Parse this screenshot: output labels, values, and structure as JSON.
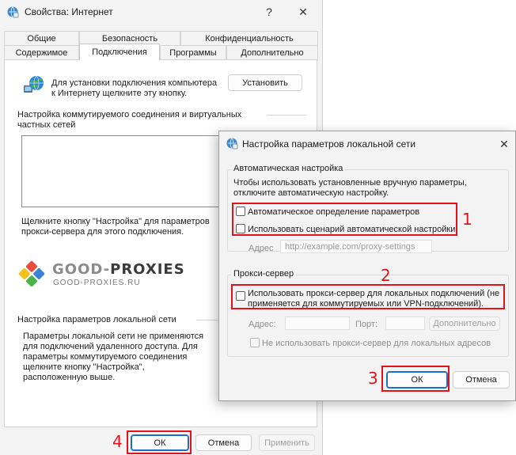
{
  "main_window": {
    "title": "Свойства: Интернет",
    "help_glyph": "?",
    "close_glyph": "✕",
    "tabs_row1": [
      "Общие",
      "Безопасность",
      "Конфиденциальность"
    ],
    "tabs_row2": [
      "Содержимое",
      "Подключения",
      "Программы",
      "Дополнительно"
    ],
    "setup_text_line1": "Для установки подключения компьютера",
    "setup_text_line2": "к Интернету щелкните эту кнопку.",
    "install_button": "Установить",
    "dialup_heading_line1": "Настройка коммутируемого соединения и виртуальных",
    "dialup_heading_line2": "частных сетей",
    "proxy_hint_line1": "Щелкните кнопку \"Настройка\" для параметров",
    "proxy_hint_line2": "прокси-сервера для этого подключения.",
    "watermark_logo_word1": "GOOD-",
    "watermark_logo_word2": "PROXIES",
    "watermark_logo_sub": "GOOD-PROXIES.RU",
    "lan_heading": "Настройка параметров локальной сети",
    "lan_text_line1": "Параметры локальной сети не применяются",
    "lan_text_line2": "для подключений удаленного доступа. Для",
    "lan_text_line3": "параметры коммутируемого соединения",
    "lan_text_line4": "щелкните кнопку \"Настройка\",",
    "lan_text_line5": "расположенную выше.",
    "ok_button": "ОК",
    "cancel_button": "Отмена",
    "apply_button": "Применить"
  },
  "lan_dialog": {
    "title": "Настройка параметров локальной сети",
    "close_glyph": "✕",
    "auto_group_title": "Автоматическая настройка",
    "auto_text_line1": "Чтобы использовать установленные вручную параметры,",
    "auto_text_line2": "отключите автоматическую настройку.",
    "auto_detect_label": "Автоматическое определение параметров",
    "auto_script_label": "Использовать сценарий автоматической настройки",
    "address_label": "Адрес",
    "address_placeholder": "http://example.com/proxy-settings",
    "proxy_group_title": "Прокси-сервер",
    "use_proxy_line1": "Использовать прокси-сервер для локальных подключений (не",
    "use_proxy_line2": "применяется для коммутируемых или VPN-подключений).",
    "proxy_address_label": "Адрес:",
    "port_label": "Порт:",
    "advanced_button": "Дополнительно",
    "bypass_label": "Не использовать прокси-сервер для локальных адресов",
    "ok_button": "ОК",
    "cancel_button": "Отмена"
  },
  "annotations": [
    "1",
    "2",
    "3",
    "4"
  ],
  "colors": {
    "annotation_red": "#e0141a",
    "primary_border": "#1a6fc4",
    "window_bg": "#f3f3f3"
  },
  "icons": [
    "internet-options-icon",
    "globe-network-icon",
    "good-proxies-logo-icon"
  ]
}
